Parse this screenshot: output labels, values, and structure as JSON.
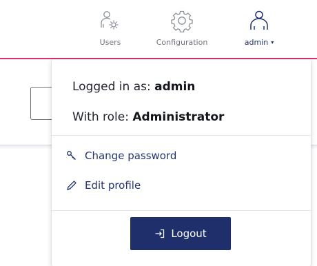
{
  "nav": {
    "items": [
      {
        "label": "Users",
        "icon": "users-gear-icon"
      },
      {
        "label": "Configuration",
        "icon": "gear-icon"
      },
      {
        "label": "admin",
        "icon": "user-icon",
        "caret": "▾"
      }
    ]
  },
  "dropdown": {
    "logged_in_prefix": "Logged in as: ",
    "username": "admin",
    "role_prefix": "With role: ",
    "role": "Administrator",
    "menu": [
      {
        "label": "Change password",
        "icon": "key-icon"
      },
      {
        "label": "Edit profile",
        "icon": "pencil-icon"
      }
    ],
    "logout_label": "Logout",
    "logout_icon": "logout-icon"
  },
  "colors": {
    "accent_line": "#d9336a",
    "primary": "#1e2f6b",
    "nav_label": "#6f737b"
  }
}
